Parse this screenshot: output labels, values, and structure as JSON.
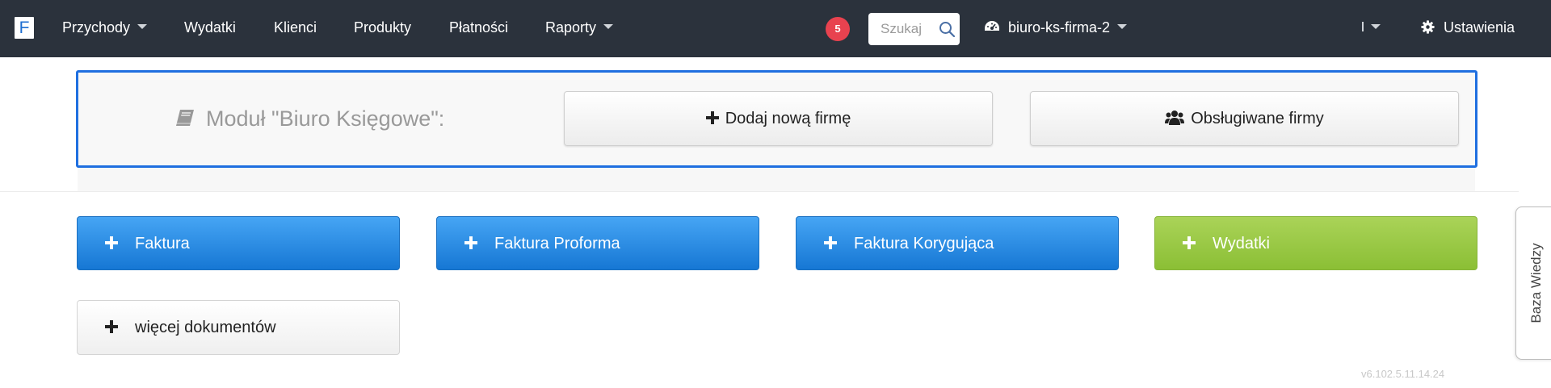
{
  "navbar": {
    "logo": "F",
    "menu": [
      {
        "label": "Przychody",
        "dropdown": true
      },
      {
        "label": "Wydatki",
        "dropdown": false
      },
      {
        "label": "Klienci",
        "dropdown": false
      },
      {
        "label": "Produkty",
        "dropdown": false
      },
      {
        "label": "Płatności",
        "dropdown": false
      },
      {
        "label": "Raporty",
        "dropdown": true
      }
    ],
    "notification_count": "5",
    "search_placeholder": "Szukaj",
    "company_name": "biuro-ks-firma-2",
    "settings_label": "Ustawienia"
  },
  "module": {
    "title": "Moduł \"Biuro Księgowe\":",
    "add_company_label": "Dodaj nową firmę",
    "served_companies_label": "Obsługiwane firmy"
  },
  "actions": {
    "invoice": "Faktura",
    "proforma": "Faktura Proforma",
    "correction": "Faktura Korygująca",
    "expenses": "Wydatki",
    "more_docs": "więcej dokumentów"
  },
  "knowledge_base": "Baza Wiedzy",
  "version": "v6.102.5.11.14.24",
  "colors": {
    "navbar": "#2b323c",
    "accent_blue": "#1f6fe0",
    "button_blue": "#2b8ae6",
    "button_green": "#9ac847",
    "badge_red": "#e8424f"
  },
  "icons": {
    "search": "search-icon",
    "dashboard": "dashboard-icon",
    "gear": "gear-icon",
    "book": "book-icon",
    "plus": "plus-icon",
    "users": "users-icon"
  }
}
